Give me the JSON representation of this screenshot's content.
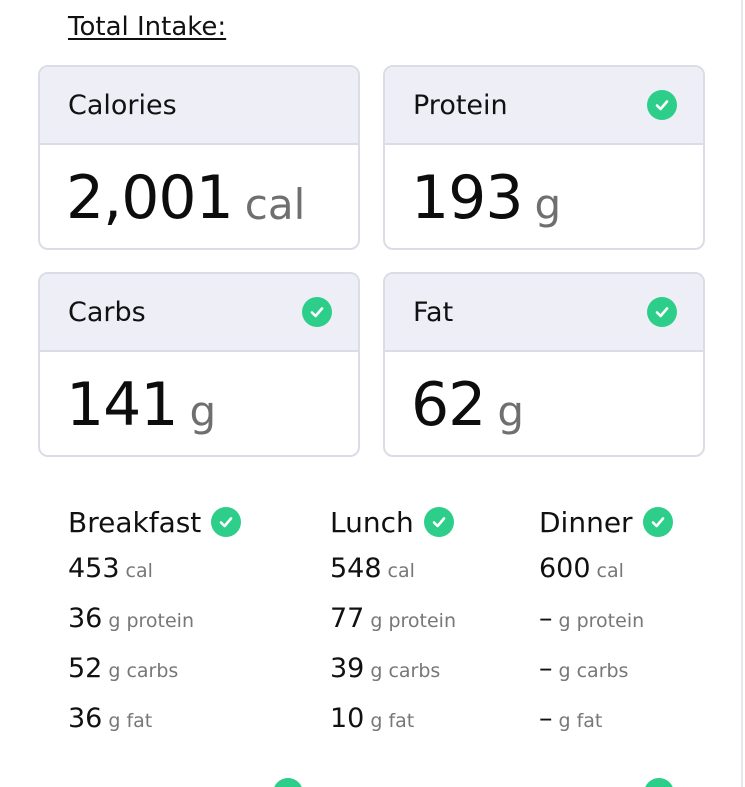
{
  "section_title": "Total Intake:",
  "cards": [
    {
      "label": "Calories",
      "value": "2,001",
      "unit": "cal",
      "checked": false
    },
    {
      "label": "Protein",
      "value": "193",
      "unit": "g",
      "checked": true
    },
    {
      "label": "Carbs",
      "value": "141",
      "unit": "g",
      "checked": true
    },
    {
      "label": "Fat",
      "value": "62",
      "unit": "g",
      "checked": true
    }
  ],
  "meals": [
    {
      "name": "Breakfast",
      "checked": true,
      "rows": [
        {
          "value": "453",
          "unit": "cal"
        },
        {
          "value": "36",
          "unit": "g protein"
        },
        {
          "value": "52",
          "unit": "g carbs"
        },
        {
          "value": "36",
          "unit": "g fat"
        }
      ]
    },
    {
      "name": "Lunch",
      "checked": true,
      "rows": [
        {
          "value": "548",
          "unit": "cal"
        },
        {
          "value": "77",
          "unit": "g protein"
        },
        {
          "value": "39",
          "unit": "g carbs"
        },
        {
          "value": "10",
          "unit": "g fat"
        }
      ]
    },
    {
      "name": "Dinner",
      "checked": true,
      "rows": [
        {
          "value": "600",
          "unit": "cal"
        },
        {
          "value": "–",
          "unit": "g protein"
        },
        {
          "value": "–",
          "unit": "g carbs"
        },
        {
          "value": "–",
          "unit": "g fat"
        }
      ]
    }
  ],
  "colors": {
    "check_green": "#2dce89",
    "card_border": "#dcdce8",
    "card_header_bg": "#eeeef6"
  },
  "icons": {
    "check": "check-circle-icon"
  }
}
